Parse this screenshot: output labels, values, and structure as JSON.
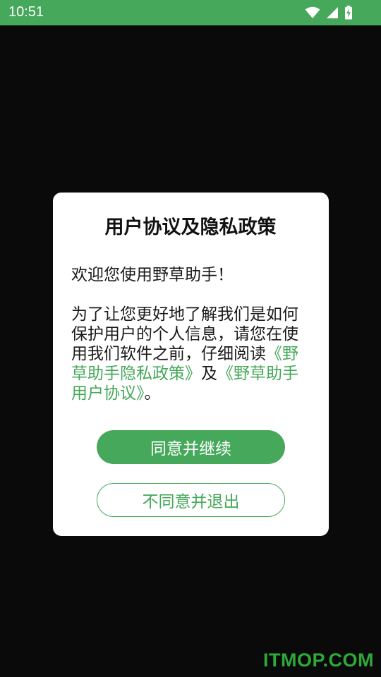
{
  "status_bar": {
    "time": "10:51",
    "icons": [
      "wifi-icon",
      "cell-signal-icon",
      "battery-charging-icon"
    ],
    "color": "#45a85a"
  },
  "dialog": {
    "title": "用户协议及隐私政策",
    "greeting": "欢迎您使用野草助手！",
    "body_text_1": "为了让您更好地了解我们是如何保护用户的个人信息，请您在使用我们软件之前，仔细阅读",
    "privacy_link": "《野草助手隐私政策》",
    "body_text_2": "及",
    "agreement_link": "《野草助手用户协议》",
    "body_text_3": "。",
    "agree_button": "同意并继续",
    "decline_button": "不同意并退出"
  },
  "colors": {
    "accent": "#45a85a",
    "background": "#0a0a0a"
  },
  "watermark": "ITMOP.COM"
}
